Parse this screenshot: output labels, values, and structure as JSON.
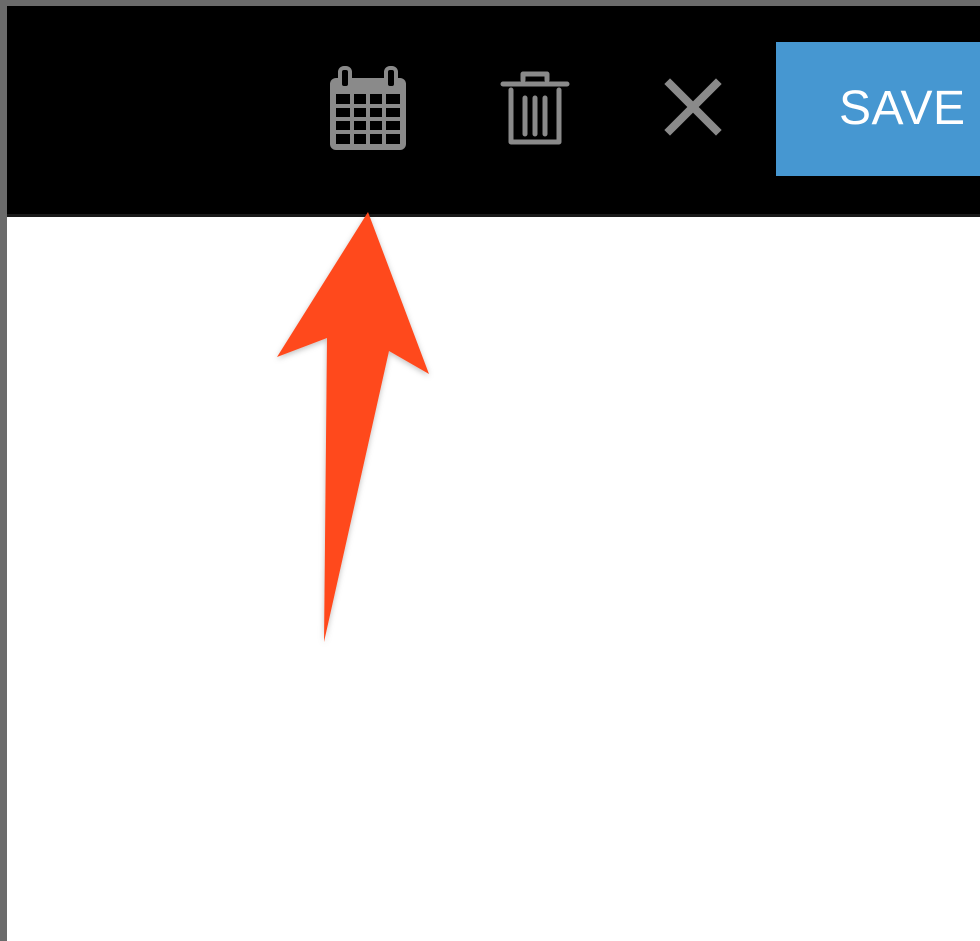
{
  "toolbar": {
    "background": "#000000",
    "icon_color": "#8a8a8a",
    "icons": {
      "calendar": "calendar-icon",
      "trash": "trash-icon",
      "close": "close-icon"
    },
    "save_label": "SAVE",
    "save_color": "#4697d1"
  },
  "annotation": {
    "arrow_color": "#ff4a1f",
    "points_to": "calendar-icon"
  }
}
